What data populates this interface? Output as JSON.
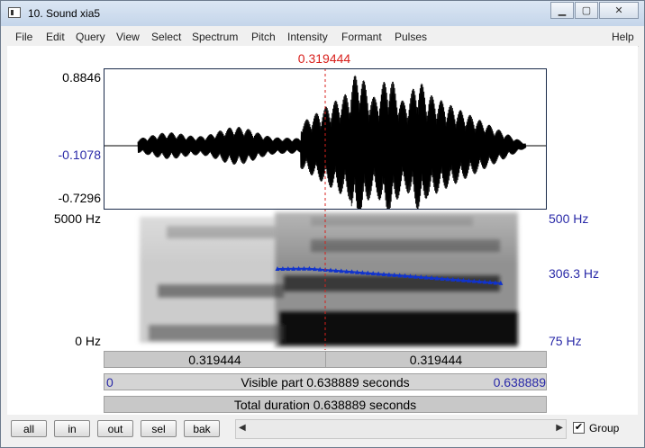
{
  "window": {
    "title": "10. Sound xia5",
    "min_icon": "minimize-icon",
    "max_icon": "maximize-icon",
    "close_icon": "close-icon"
  },
  "menu": [
    "File",
    "Edit",
    "Query",
    "View",
    "Select",
    "Spectrum",
    "Pitch",
    "Intensity",
    "Formant",
    "Pulses",
    "Help"
  ],
  "cursor": {
    "time": "0.319444",
    "color": "#d8201c"
  },
  "waveform": {
    "max": "0.8846",
    "mid": "-0.1078",
    "min": "-0.7296"
  },
  "spectrogram": {
    "top_freq": "5000 Hz",
    "bottom_freq": "0 Hz"
  },
  "pitch": {
    "top": "500 Hz",
    "current": "306.3 Hz",
    "bottom": "75 Hz",
    "color": "#1133cc"
  },
  "bars": {
    "left_part": "0.319444",
    "right_part": "0.319444",
    "visible_start": "0",
    "visible": "Visible part 0.638889 seconds",
    "visible_end": "0.638889",
    "total": "Total duration 0.638889 seconds"
  },
  "buttons": [
    "all",
    "in",
    "out",
    "sel",
    "bak"
  ],
  "group": {
    "label": "Group",
    "checked": true
  }
}
